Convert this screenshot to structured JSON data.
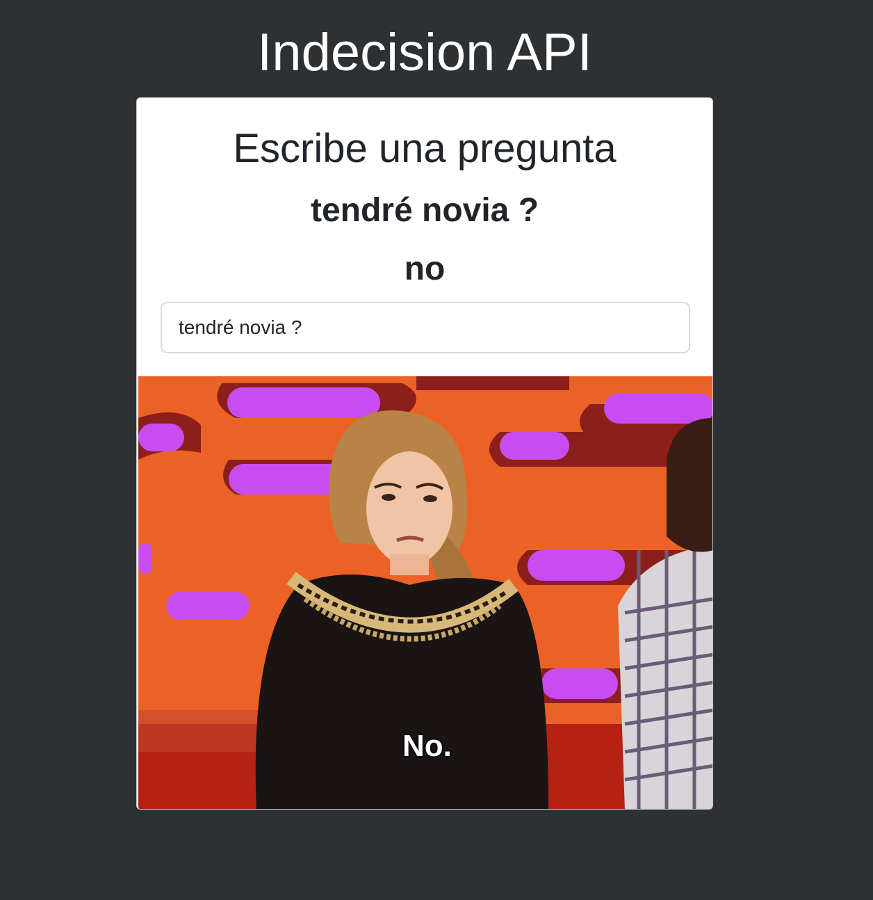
{
  "app": {
    "title": "Indecision API"
  },
  "card": {
    "heading": "Escribe una pregunta",
    "question_echo": "tendré novia ?",
    "answer": "no",
    "input": {
      "value": "tendré novia ?",
      "placeholder": ""
    },
    "image": {
      "caption": "No."
    }
  },
  "colors": {
    "page_background": "#2d3134",
    "card_background": "#ffffff",
    "text_dark": "#212529",
    "image_orange": "#e85b22",
    "image_magenta": "#c84df0"
  }
}
